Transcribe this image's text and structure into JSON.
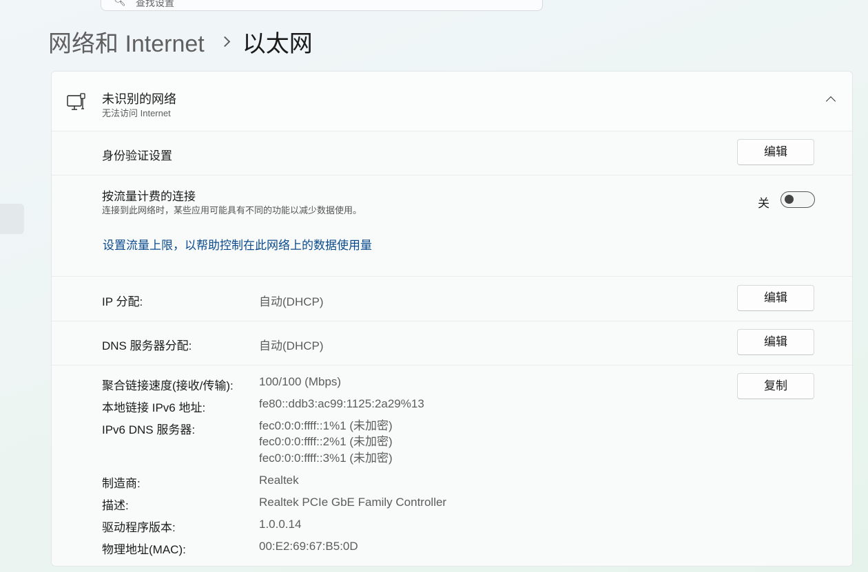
{
  "search": {
    "placeholder": "查找设置"
  },
  "breadcrumb": {
    "parent": "网络和 Internet",
    "current": "以太网"
  },
  "network": {
    "name": "未识别的网络",
    "status": "无法访问 Internet",
    "icon": "ethernet-monitor-icon"
  },
  "auth": {
    "label": "身份验证设置",
    "button": "编辑"
  },
  "metered": {
    "label": "按流量计费的连接",
    "description": "连接到此网络时，某些应用可能具有不同的功能以减少数据使用。",
    "state_label": "关",
    "on": false,
    "link": "设置流量上限，以帮助控制在此网络上的数据使用量"
  },
  "ip": {
    "label": "IP 分配:",
    "value": "自动(DHCP)",
    "button": "编辑"
  },
  "dns": {
    "label": "DNS 服务器分配:",
    "value": "自动(DHCP)",
    "button": "编辑"
  },
  "properties": {
    "copy_button": "复制",
    "items": [
      {
        "label": "聚合链接速度(接收/传输):",
        "value": "100/100 (Mbps)"
      },
      {
        "label": "本地链接 IPv6 地址:",
        "value": "fe80::ddb3:ac99:1125:2a29%13"
      },
      {
        "label": "IPv6 DNS 服务器:",
        "values": [
          "fec0:0:0:ffff::1%1 (未加密)",
          "fec0:0:0:ffff::2%1 (未加密)",
          "fec0:0:0:ffff::3%1 (未加密)"
        ]
      },
      {
        "label": "制造商:",
        "value": "Realtek"
      },
      {
        "label": "描述:",
        "value": "Realtek PCIe GbE Family Controller"
      },
      {
        "label": "驱动程序版本:",
        "value": "1.0.0.14"
      },
      {
        "label": "物理地址(MAC):",
        "value": "00:E2:69:67:B5:0D"
      }
    ]
  },
  "colors": {
    "link": "#0a4a8c",
    "toggle_knob": "#444444"
  }
}
